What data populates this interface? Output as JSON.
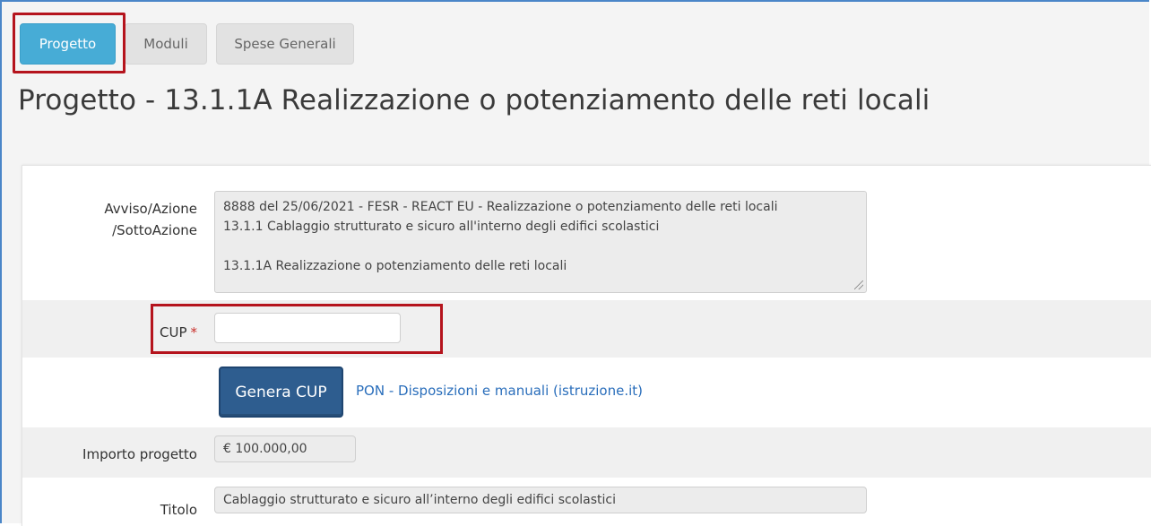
{
  "tabs": [
    {
      "label": "Progetto",
      "active": true
    },
    {
      "label": "Moduli",
      "active": false
    },
    {
      "label": "Spese Generali",
      "active": false
    }
  ],
  "page_title": "Progetto - 13.1.1A Realizzazione o potenziamento delle reti locali",
  "form": {
    "avviso": {
      "label_line1": "Avviso/Azione",
      "label_line2": "/SottoAzione",
      "line1": "8888 del 25/06/2021 - FESR - REACT EU - Realizzazione o potenziamento delle reti locali",
      "line2": "13.1.1  Cablaggio strutturato e sicuro all'interno degli edifici scolastici",
      "line3": "",
      "line4": "13.1.1A Realizzazione o potenziamento delle reti locali"
    },
    "cup": {
      "label": "CUP",
      "required_mark": "*",
      "value": ""
    },
    "genera_cup_button": "Genera CUP",
    "manuals_link": "PON - Disposizioni e manuali (istruzione.it)",
    "importo": {
      "label": "Importo progetto",
      "value": "€ 100.000,00"
    },
    "titolo": {
      "label": "Titolo",
      "value": "Cablaggio strutturato e sicuro all’interno degli edifici scolastici"
    }
  },
  "colors": {
    "active_tab": "#47acd6",
    "button_primary": "#2e5d8f",
    "highlight_box": "#b5141d",
    "link": "#2a6ebb"
  }
}
